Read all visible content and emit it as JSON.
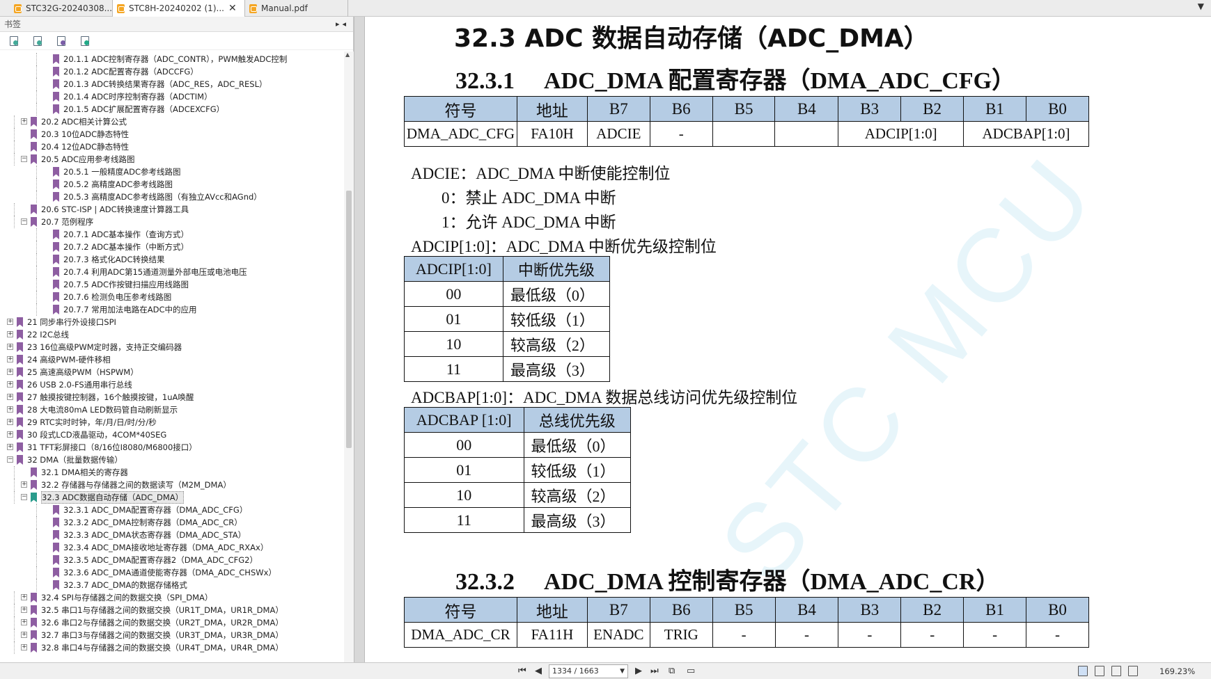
{
  "tabs": [
    {
      "label": "STC32G-20240308...",
      "active": false
    },
    {
      "label": "STC8H-20240202 (1)...",
      "active": true
    },
    {
      "label": "Manual.pdf",
      "active": false
    }
  ],
  "left_panel": {
    "title": "书签",
    "tree": [
      {
        "label": "20.1.1 ADC控制寄存器（ADC_CONTR），PWM触发ADC控制",
        "level": 2
      },
      {
        "label": "20.1.2  ADC配置寄存器（ADCCFG）",
        "level": 2
      },
      {
        "label": "20.1.3 ADC转换结果寄存器（ADC_RES，ADC_RESL）",
        "level": 2
      },
      {
        "label": "20.1.4  ADC时序控制寄存器（ADCTIM）",
        "level": 2
      },
      {
        "label": "20.1.5  ADC扩展配置寄存器（ADCEXCFG）",
        "level": 2
      },
      {
        "label": "20.2  ADC相关计算公式",
        "level": 1,
        "expander": "+"
      },
      {
        "label": "20.3  10位ADC静态特性",
        "level": 1
      },
      {
        "label": "20.4 12位ADC静态特性",
        "level": 1
      },
      {
        "label": "20.5  ADC应用参考线路图",
        "level": 1,
        "expander": "-"
      },
      {
        "label": "20.5.1 一般精度ADC参考线路图",
        "level": 2
      },
      {
        "label": "20.5.2  高精度ADC参考线路图",
        "level": 2
      },
      {
        "label": "20.5.3  高精度ADC参考线路图（有独立AVcc和AGnd）",
        "level": 2
      },
      {
        "label": "20.6  STC-ISP | ADC转换速度计算器工具",
        "level": 1
      },
      {
        "label": "20.7  范例程序",
        "level": 1,
        "expander": "-"
      },
      {
        "label": "20.7.1 ADC基本操作（查询方式）",
        "level": 2
      },
      {
        "label": "20.7.2 ADC基本操作（中断方式）",
        "level": 2
      },
      {
        "label": "20.7.3 格式化ADC转换结果",
        "level": 2
      },
      {
        "label": "20.7.4 利用ADC第15通道测量外部电压或电池电压",
        "level": 2
      },
      {
        "label": "20.7.5 ADC作按键扫描应用线路图",
        "level": 2
      },
      {
        "label": "20.7.6  检测负电压参考线路图",
        "level": 2
      },
      {
        "label": "20.7.7  常用加法电路在ADC中的应用",
        "level": 2
      },
      {
        "label": "21  同步串行外设接口SPI",
        "level": 0,
        "expander": "+"
      },
      {
        "label": "22  I2C总线",
        "level": 0,
        "expander": "+"
      },
      {
        "label": "23  16位高级PWM定时器，支持正交编码器",
        "level": 0,
        "expander": "+"
      },
      {
        "label": "24  高级PWM-硬件移相",
        "level": 0,
        "expander": "+"
      },
      {
        "label": "25  高速高级PWM（HSPWM）",
        "level": 0,
        "expander": "+"
      },
      {
        "label": "26  USB 2.0-FS通用串行总线",
        "level": 0,
        "expander": "+"
      },
      {
        "label": "27  触摸按键控制器，16个触摸按键，1uA唤醒",
        "level": 0,
        "expander": "+"
      },
      {
        "label": "28  大电流80mA LED数码管自动刷新显示",
        "level": 0,
        "expander": "+"
      },
      {
        "label": "29  RTC实时时钟，年/月/日/时/分/秒",
        "level": 0,
        "expander": "+"
      },
      {
        "label": "30  段式LCD液晶驱动，4COM*40SEG",
        "level": 0,
        "expander": "+"
      },
      {
        "label": "31  TFT彩屏接口（8/16位I8080/M6800接口）",
        "level": 0,
        "expander": "+"
      },
      {
        "label": "32  DMA（批量数据传输）",
        "level": 0,
        "expander": "-"
      },
      {
        "label": "32.1 DMA相关的寄存器",
        "level": 1
      },
      {
        "label": "32.2 存储器与存储器之间的数据读写（M2M_DMA）",
        "level": 1,
        "expander": "+"
      },
      {
        "label": "32.3 ADC数据自动存储（ADC_DMA）",
        "level": 1,
        "expander": "-",
        "selected": true
      },
      {
        "label": "32.3.1 ADC_DMA配置寄存器（DMA_ADC_CFG）",
        "level": 2
      },
      {
        "label": "32.3.2 ADC_DMA控制寄存器（DMA_ADC_CR）",
        "level": 2
      },
      {
        "label": "32.3.3  ADC_DMA状态寄存器（DMA_ADC_STA）",
        "level": 2
      },
      {
        "label": "32.3.4 ADC_DMA接收地址寄存器（DMA_ADC_RXAx）",
        "level": 2
      },
      {
        "label": "32.3.5 ADC_DMA配置寄存器2（DMA_ADC_CFG2）",
        "level": 2
      },
      {
        "label": "32.3.6 ADC_DMA通道使能寄存器（DMA_ADC_CHSWx）",
        "level": 2
      },
      {
        "label": "32.3.7  ADC_DMA的数据存储格式",
        "level": 2
      },
      {
        "label": "32.4  SPI与存储器之间的数据交换（SPI_DMA）",
        "level": 1,
        "expander": "+"
      },
      {
        "label": "32.5  串口1与存储器之间的数据交换（UR1T_DMA，UR1R_DMA）",
        "level": 1,
        "expander": "+"
      },
      {
        "label": "32.6 串口2与存储器之间的数据交换（UR2T_DMA，UR2R_DMA）",
        "level": 1,
        "expander": "+"
      },
      {
        "label": "32.7 串口3与存储器之间的数据交换（UR3T_DMA，UR3R_DMA）",
        "level": 1,
        "expander": "+"
      },
      {
        "label": "32.8  串口4与存储器之间的数据交换（UR4T_DMA，UR4R_DMA）",
        "level": 1,
        "expander": "+"
      }
    ]
  },
  "document": {
    "heading_main": "32.3   ADC 数据自动存储（ADC_DMA）",
    "h1_num": "32.3.1",
    "h1_text": "ADC_DMA 配置寄存器（DMA_ADC_CFG）",
    "reg1": {
      "headers": [
        "符号",
        "地址",
        "B7",
        "B6",
        "B5",
        "B4",
        "B3",
        "B2",
        "B1",
        "B0"
      ],
      "row": {
        "sym": "DMA_ADC_CFG",
        "addr": "FA10H",
        "b7": "ADCIE",
        "b6": "-",
        "b5": "",
        "b4": "",
        "b3b2": "ADCIP[1:0]",
        "b1b0": "ADCBAP[1:0]"
      }
    },
    "p_adcie": "ADCIE：ADC_DMA 中断使能控制位",
    "p_adcie_0": "0：禁止 ADC_DMA 中断",
    "p_adcie_1": "1：允许 ADC_DMA 中断",
    "p_adcip": "ADCIP[1:0]：ADC_DMA 中断优先级控制位",
    "tbl_adcip": {
      "headers": [
        "ADCIP[1:0]",
        "中断优先级"
      ],
      "rows": [
        [
          "00",
          "最低级（0）"
        ],
        [
          "01",
          "较低级（1）"
        ],
        [
          "10",
          "较高级（2）"
        ],
        [
          "11",
          "最高级（3）"
        ]
      ]
    },
    "p_adcbap": "ADCBAP[1:0]：ADC_DMA 数据总线访问优先级控制位",
    "tbl_adcbap": {
      "headers": [
        "ADCBAP [1:0]",
        "总线优先级"
      ],
      "rows": [
        [
          "00",
          "最低级（0）"
        ],
        [
          "01",
          "较低级（1）"
        ],
        [
          "10",
          "较高级（2）"
        ],
        [
          "11",
          "最高级（3）"
        ]
      ]
    },
    "h2_num": "32.3.2",
    "h2_text": "ADC_DMA 控制寄存器（DMA_ADC_CR）",
    "reg2": {
      "headers": [
        "符号",
        "地址",
        "B7",
        "B6",
        "B5",
        "B4",
        "B3",
        "B2",
        "B1",
        "B0"
      ],
      "row": [
        "DMA_ADC_CR",
        "FA11H",
        "ENADC",
        "TRIG",
        "-",
        "-",
        "-",
        "-",
        "-",
        "-"
      ]
    },
    "watermark": "STC MCU"
  },
  "statusbar": {
    "page_value": "1334 / 1663",
    "zoom": "169.23%"
  }
}
